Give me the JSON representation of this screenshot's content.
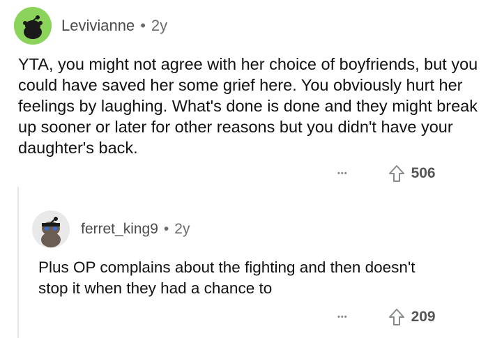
{
  "comments": [
    {
      "username": "Levivianne",
      "separator": "•",
      "age": "2y",
      "body": "YTA, you might not agree with her choice of boyfriends, but you could have saved her some grief here. You obviously hurt her feelings by laughing. What's done is done and they might break up sooner or later for other reasons but you didn't have your daughter's back.",
      "more": "•••",
      "upvotes": "506",
      "avatar_color": "#8bd35a"
    },
    {
      "username": "ferret_king9",
      "separator": "•",
      "age": "2y",
      "body": "Plus OP complains about the fighting and then doesn't stop it when they had a chance to",
      "more": "•••",
      "upvotes": "209",
      "avatar_color": "#e9e9e9"
    }
  ],
  "icons": {
    "upvote": "upvote-arrow-icon",
    "more": "more-options-icon"
  }
}
